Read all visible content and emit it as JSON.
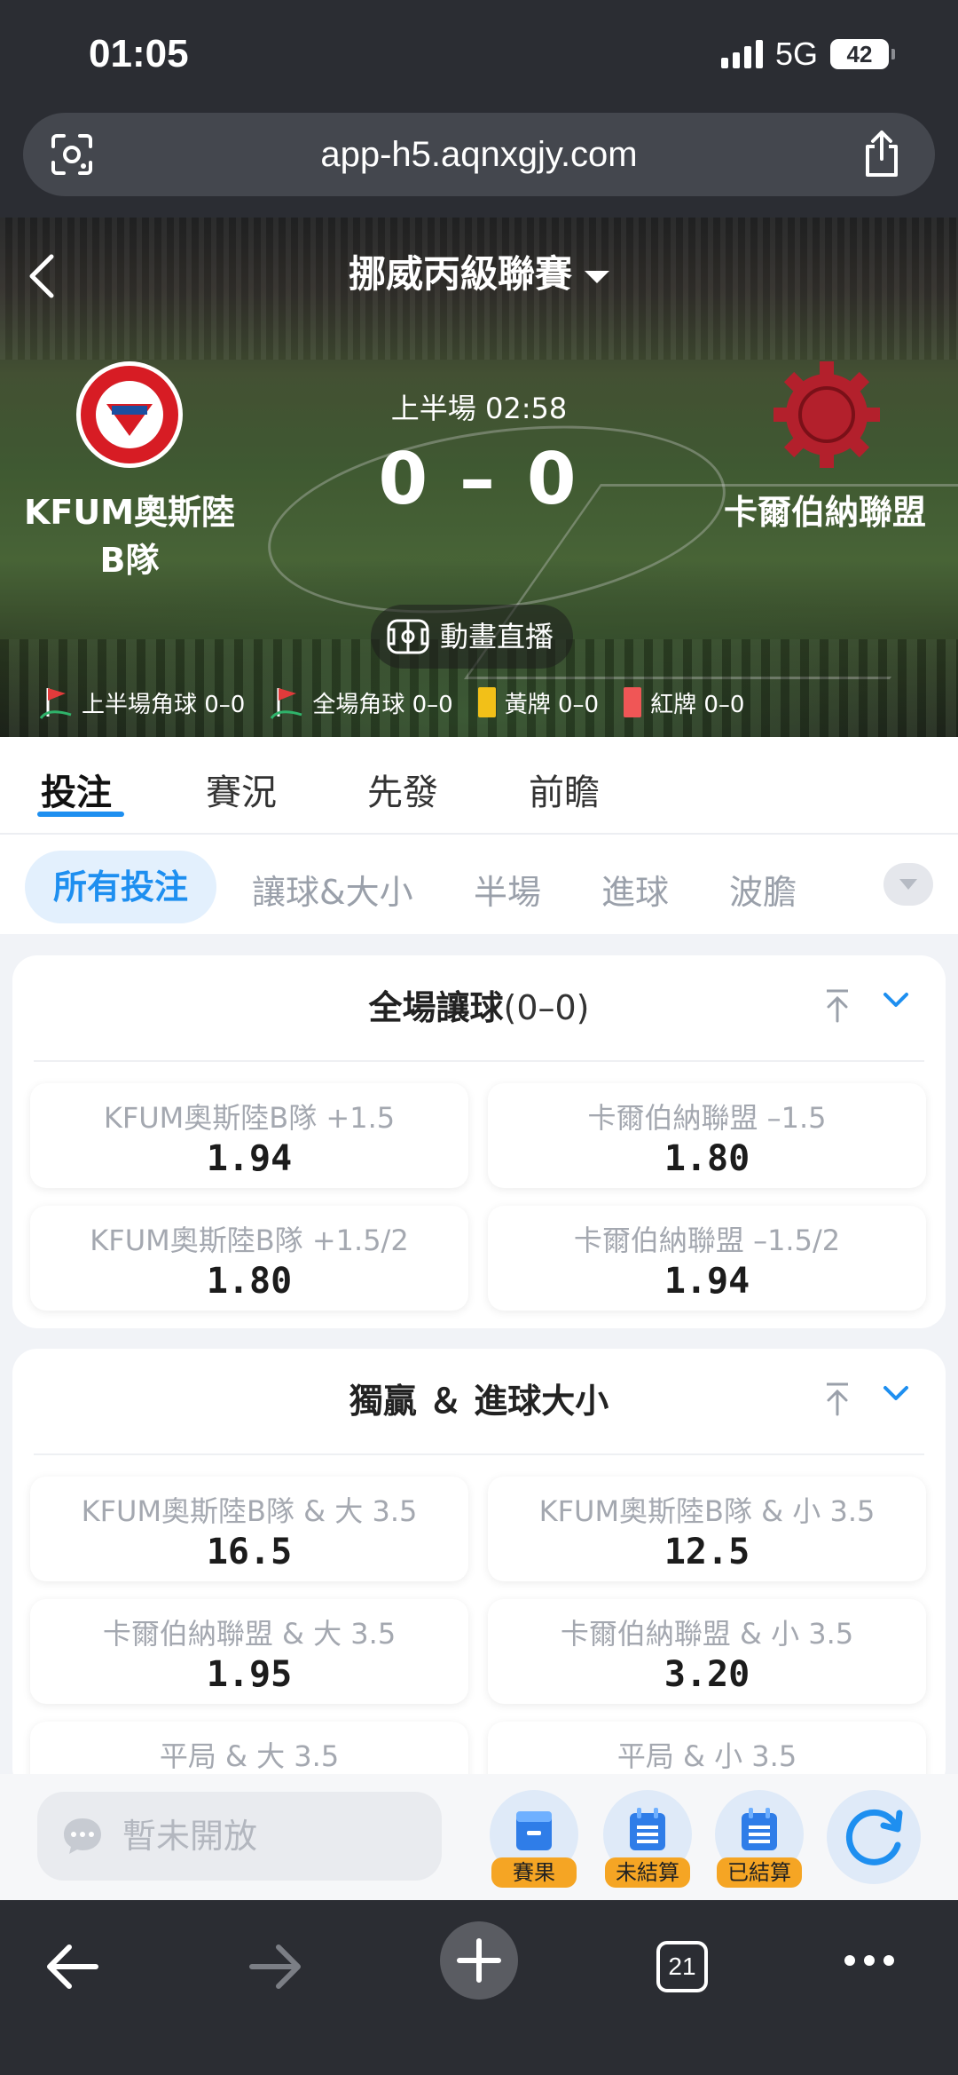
{
  "status_bar": {
    "time": "01:05",
    "network": "5G",
    "battery": "42"
  },
  "browser": {
    "url": "app-h5.aqnxgjy.com",
    "tabs_count": "21"
  },
  "header": {
    "league": "挪威丙級聯賽",
    "period_time": "上半場 02:58",
    "score": "0 – 0",
    "home_team": {
      "name_line1": "KFUM奧斯陸",
      "name_line2": "B隊"
    },
    "away_team": {
      "name": "卡爾伯納聯盟"
    },
    "animation_button": "動畫直播",
    "stats": {
      "half_corners": "上半場角球 0–0",
      "full_corners": "全場角球 0–0",
      "yellow_cards": "黃牌 0–0",
      "red_cards": "紅牌 0–0"
    }
  },
  "main_tabs": [
    "投注",
    "賽況",
    "先發",
    "前瞻"
  ],
  "sub_tabs": [
    "所有投注",
    "讓球&大小",
    "半場",
    "進球",
    "波膽"
  ],
  "markets": {
    "handicap": {
      "title": "全場讓球",
      "title_suffix": "(0–0)",
      "odds": [
        {
          "label": "KFUM奧斯陸B隊 +1.5",
          "price": "1.94"
        },
        {
          "label": "卡爾伯納聯盟 –1.5",
          "price": "1.80"
        },
        {
          "label": "KFUM奧斯陸B隊 +1.5/2",
          "price": "1.80"
        },
        {
          "label": "卡爾伯納聯盟 –1.5/2",
          "price": "1.94"
        }
      ]
    },
    "win_total": {
      "title": "獨贏 ＆ 進球大小",
      "odds": [
        {
          "label": "KFUM奧斯陸B隊 & 大 3.5",
          "price": "16.5"
        },
        {
          "label": "KFUM奧斯陸B隊 & 小 3.5",
          "price": "12.5"
        },
        {
          "label": "卡爾伯納聯盟 & 大 3.5",
          "price": "1.95"
        },
        {
          "label": "卡爾伯納聯盟 & 小 3.5",
          "price": "3.20"
        },
        {
          "label": "平局 & 大 3.5",
          "price": ""
        },
        {
          "label": "平局 & 小 3.5",
          "price": ""
        }
      ]
    }
  },
  "action_bar": {
    "chat_placeholder": "暫未開放",
    "buttons": [
      "賽果",
      "未結算",
      "已結算"
    ]
  },
  "colors": {
    "accent": "#1e8ff0",
    "badge": "#f5a524",
    "yellow_card": "#f2c018",
    "red_card": "#f05656",
    "corner_flag": "#e23b3b"
  }
}
